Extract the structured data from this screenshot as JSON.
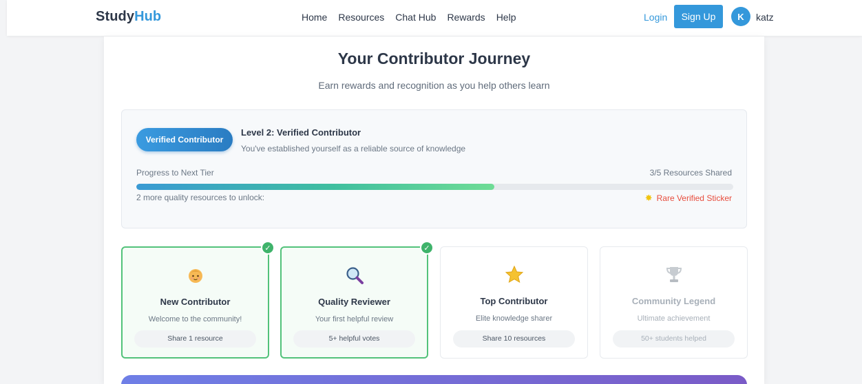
{
  "nav": {
    "logo_part1": "Study",
    "logo_part2": "Hub",
    "links": [
      "Home",
      "Resources",
      "Chat Hub",
      "Rewards",
      "Help"
    ],
    "login": "Login",
    "signup": "Sign Up",
    "avatar_initial": "K",
    "username": "katz"
  },
  "header": {
    "title": "Your Contributor Journey",
    "subtitle": "Earn rewards and recognition as you help others learn"
  },
  "tier": {
    "badge": "Verified Contributor",
    "level": "Level 2: Verified Contributor",
    "description": "You've established yourself as a reliable source of knowledge",
    "progress_label": "Progress to Next Tier",
    "progress_count": "3/5 Resources Shared",
    "progress_fraction": 0.6,
    "unlock_label": "2 more quality resources to unlock:",
    "reward_icon": "sparkle-icon",
    "reward": "Rare Verified Sticker"
  },
  "badges": [
    {
      "icon": "baby-face-icon",
      "title": "New Contributor",
      "description": "Welcome to the community!",
      "requirement": "Share 1 resource",
      "earned": true
    },
    {
      "icon": "magnifier-icon",
      "title": "Quality Reviewer",
      "description": "Your first helpful review",
      "requirement": "5+ helpful votes",
      "earned": true
    },
    {
      "icon": "star-icon",
      "title": "Top Contributor",
      "description": "Elite knowledge sharer",
      "requirement": "Share 10 resources",
      "earned": false
    },
    {
      "icon": "trophy-icon",
      "title": "Community Legend",
      "description": "Ultimate achievement",
      "requirement": "50+ students helped",
      "earned": false,
      "locked": true
    }
  ],
  "colors": {
    "accent": "#3498db",
    "earned_border": "#52c27a",
    "reward_red": "#e74c3c"
  }
}
